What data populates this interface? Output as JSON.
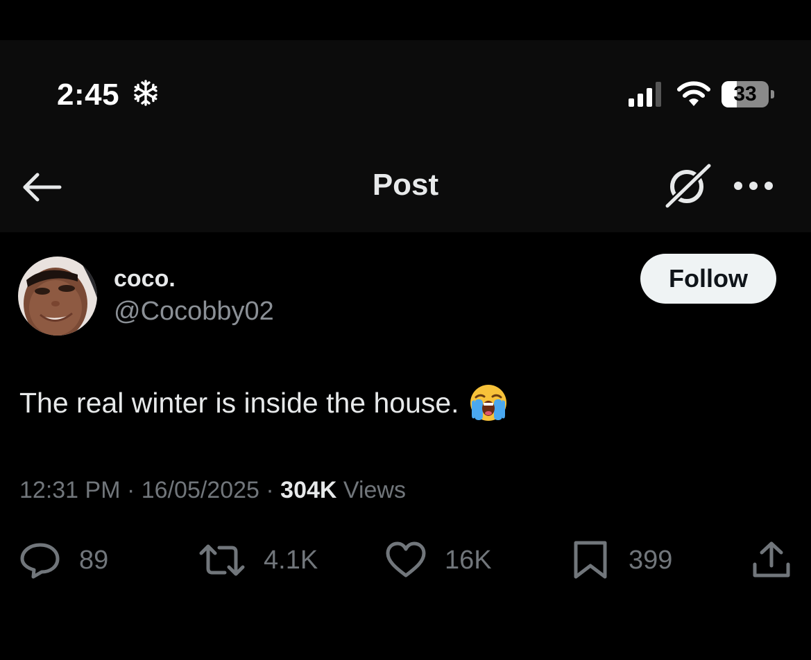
{
  "colors": {
    "background": "#000000",
    "header_background": "#0c0c0c",
    "primary_text": "#e7e9ea",
    "secondary_text": "#71767b",
    "follow_button_bg": "#eff3f4"
  },
  "status_bar": {
    "time": "2:45",
    "focus_icon": "snowflake-icon",
    "battery_level": "33",
    "battery_fraction": 0.33
  },
  "nav": {
    "title": "Post",
    "back_icon": "arrow-left-icon",
    "grok_icon": "grok-icon",
    "more_icon": "more-horizontal-icon"
  },
  "author": {
    "display_name": "coco.",
    "handle": "@Cocobby02",
    "follow_label": "Follow"
  },
  "post": {
    "text": "The real winter is inside the house.",
    "emoji": "loudly-crying-face"
  },
  "meta": {
    "time": "12:31 PM",
    "separator": "·",
    "date": "16/05/2025",
    "views_count": "304K",
    "views_label": "Views"
  },
  "actions": {
    "replies": {
      "icon": "reply-icon",
      "count": "89"
    },
    "reposts": {
      "icon": "repost-icon",
      "count": "4.1K"
    },
    "likes": {
      "icon": "heart-icon",
      "count": "16K"
    },
    "bookmarks": {
      "icon": "bookmark-icon",
      "count": "399"
    },
    "share": {
      "icon": "share-icon"
    }
  }
}
